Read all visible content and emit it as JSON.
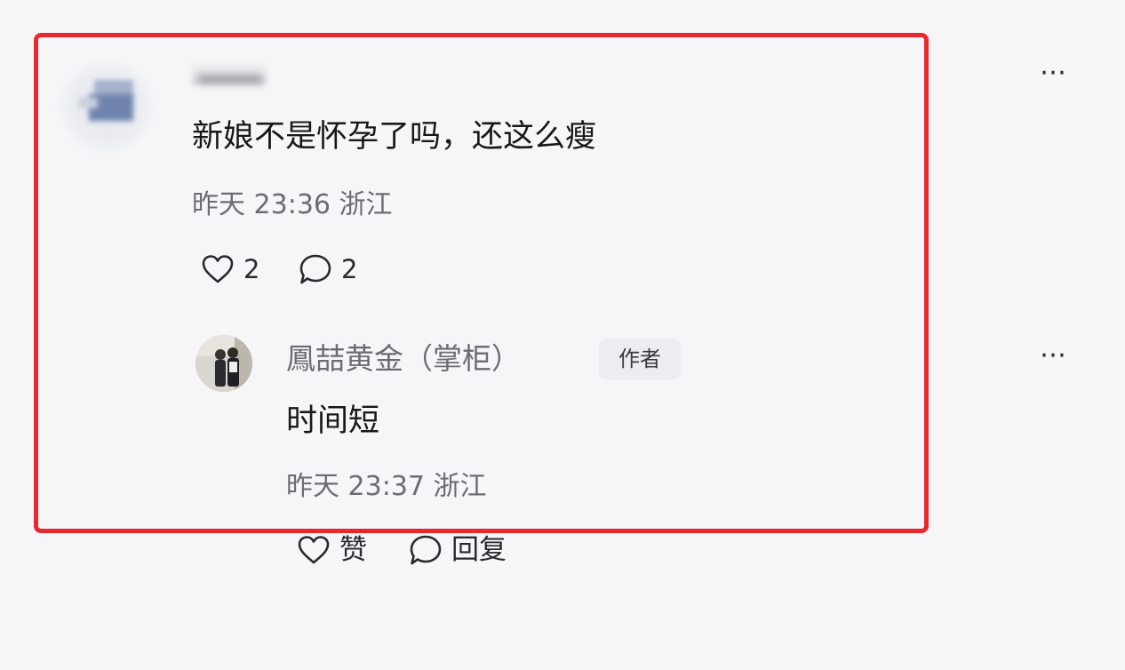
{
  "comment": {
    "text": "新娘不是怀孕了吗，还这么瘦",
    "time": "昨天 23:36",
    "location": "浙江",
    "likes": "2",
    "replies": "2"
  },
  "reply": {
    "username": "鳳喆黄金（掌柜）",
    "badge": "作者",
    "text": "时间短",
    "time": "昨天 23:37",
    "location": "浙江",
    "like_label": "赞",
    "reply_label": "回复"
  },
  "more_icon": "⋯",
  "colors": {
    "highlight": "#e8272e",
    "background": "#f6f6f8",
    "meta_text": "#6c6c72"
  }
}
